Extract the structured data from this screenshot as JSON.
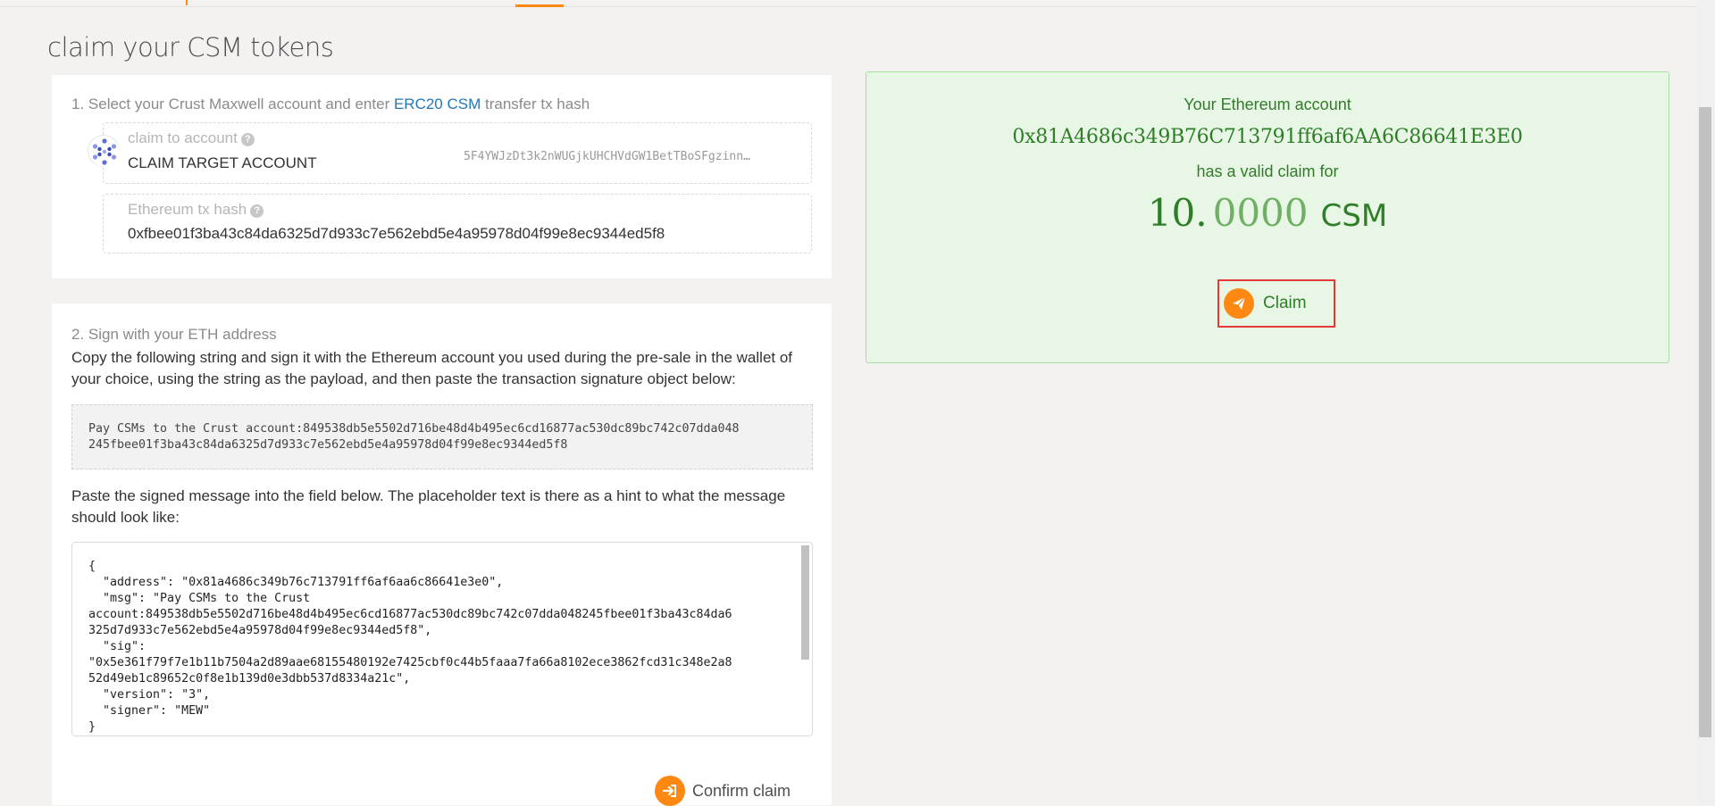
{
  "page": {
    "title": "claim your CSM tokens"
  },
  "step1": {
    "title_prefix": "1. Select your Crust Maxwell account and enter ",
    "title_link": "ERC20 CSM",
    "title_suffix": " transfer tx hash",
    "account": {
      "label": "claim to account",
      "help_icon": "question-icon",
      "name": "CLAIM TARGET ACCOUNT",
      "address": "5F4YWJzDt3k2nWUGjkUHCHVdGW1BetTBoSFgzinn…"
    },
    "tx_hash": {
      "label": "Ethereum tx hash",
      "help_icon": "question-icon",
      "value": "0xfbee01f3ba43c84da6325d7d933c7e562ebd5e4a95978d04f99e8ec9344ed5f8"
    }
  },
  "step2": {
    "title": "2. Sign with your ETH address",
    "instructions": "Copy the following string and sign it with the Ethereum account you used during the pre-sale in the wallet of your choice, using the string as the payload, and then paste the transaction signature object below:",
    "payload": "Pay CSMs to the Crust account:849538db5e5502d716be48d4b495ec6cd16877ac530dc89bc742c07dda048\n245fbee01f3ba43c84da6325d7d933c7e562ebd5e4a95978d04f99e8ec9344ed5f8",
    "paste_hint": "Paste the signed message into the field below. The placeholder text is there as a hint to what the message should look like:",
    "signed_message": "{\n  \"address\": \"0x81a4686c349b76c713791ff6af6aa6c86641e3e0\",\n  \"msg\": \"Pay CSMs to the Crust\naccount:849538db5e5502d716be48d4b495ec6cd16877ac530dc89bc742c07dda048245fbee01f3ba43c84da6\n325d7d933c7e562ebd5e4a95978d04f99e8ec9344ed5f8\",\n  \"sig\":\n\"0x5e361f79f7e1b11b7504a2d89aae68155480192e7425cbf0c44b5faaa7fa66a8102ece3862fcd31c348e2a8\n52d49eb1c89652c0f8e1b139d0e3dbb537d8334a21c\",\n  \"version\": \"3\",\n  \"signer\": \"MEW\"\n}",
    "confirm_label": "Confirm claim",
    "confirm_icon": "sign-in-arrow-icon"
  },
  "claim_panel": {
    "eth_account_label": "Your Ethereum account",
    "eth_address": "0x81A4686c349B76C713791ff6af6AA6C86641E3E0",
    "valid_claim_text": "has a valid claim for",
    "amount_int": "10.",
    "amount_dec": "0000",
    "amount_unit": "CSM",
    "claim_label": "Claim",
    "claim_icon": "paper-plane-icon"
  },
  "colors": {
    "accent": "#ff8812",
    "link": "#2477b3",
    "success_text": "#2e7d27",
    "success_bg": "#e8f6e6",
    "highlight_border": "#e53935"
  }
}
